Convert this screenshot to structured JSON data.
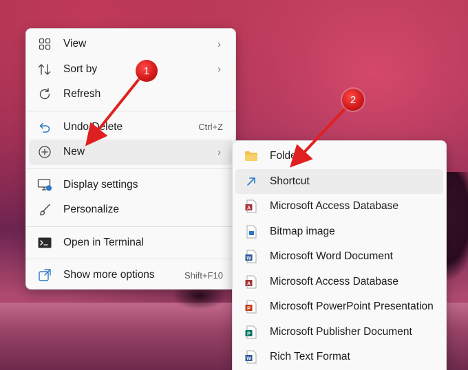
{
  "context_menu": {
    "items": [
      {
        "label": "View",
        "icon": "grid-icon",
        "has_submenu": true
      },
      {
        "label": "Sort by",
        "icon": "sort-icon",
        "has_submenu": true
      },
      {
        "label": "Refresh",
        "icon": "refresh-icon"
      },
      {
        "label": "Undo Delete",
        "icon": "undo-icon",
        "shortcut": "Ctrl+Z"
      },
      {
        "label": "New",
        "icon": "plus-circle-icon",
        "has_submenu": true
      },
      {
        "label": "Display settings",
        "icon": "display-icon"
      },
      {
        "label": "Personalize",
        "icon": "brush-icon"
      },
      {
        "label": "Open in Terminal",
        "icon": "terminal-icon"
      },
      {
        "label": "Show more options",
        "icon": "external-icon",
        "shortcut": "Shift+F10"
      }
    ]
  },
  "new_submenu": {
    "items": [
      {
        "label": "Folder",
        "icon": "folder-icon"
      },
      {
        "label": "Shortcut",
        "icon": "shortcut-arrow-icon"
      },
      {
        "label": "Microsoft Access Database",
        "icon": "access-icon"
      },
      {
        "label": "Bitmap image",
        "icon": "bitmap-icon"
      },
      {
        "label": "Microsoft Word Document",
        "icon": "word-icon"
      },
      {
        "label": "Microsoft Access Database",
        "icon": "access-icon"
      },
      {
        "label": "Microsoft PowerPoint Presentation",
        "icon": "powerpoint-icon"
      },
      {
        "label": "Microsoft Publisher Document",
        "icon": "publisher-icon"
      },
      {
        "label": "Rich Text Format",
        "icon": "rtf-icon"
      }
    ]
  },
  "annotations": {
    "step1": "1",
    "step2": "2"
  },
  "colors": {
    "annotation_red": "#e02020",
    "menu_bg": "#f9f9f9",
    "highlight": "#ececec",
    "folder": "#f2c14e",
    "access": "#a4373a",
    "word": "#2b5797",
    "powerpoint": "#c43e1c",
    "publisher": "#077568",
    "shortcut": "#2a78c8"
  },
  "submenu_chevron": "›"
}
